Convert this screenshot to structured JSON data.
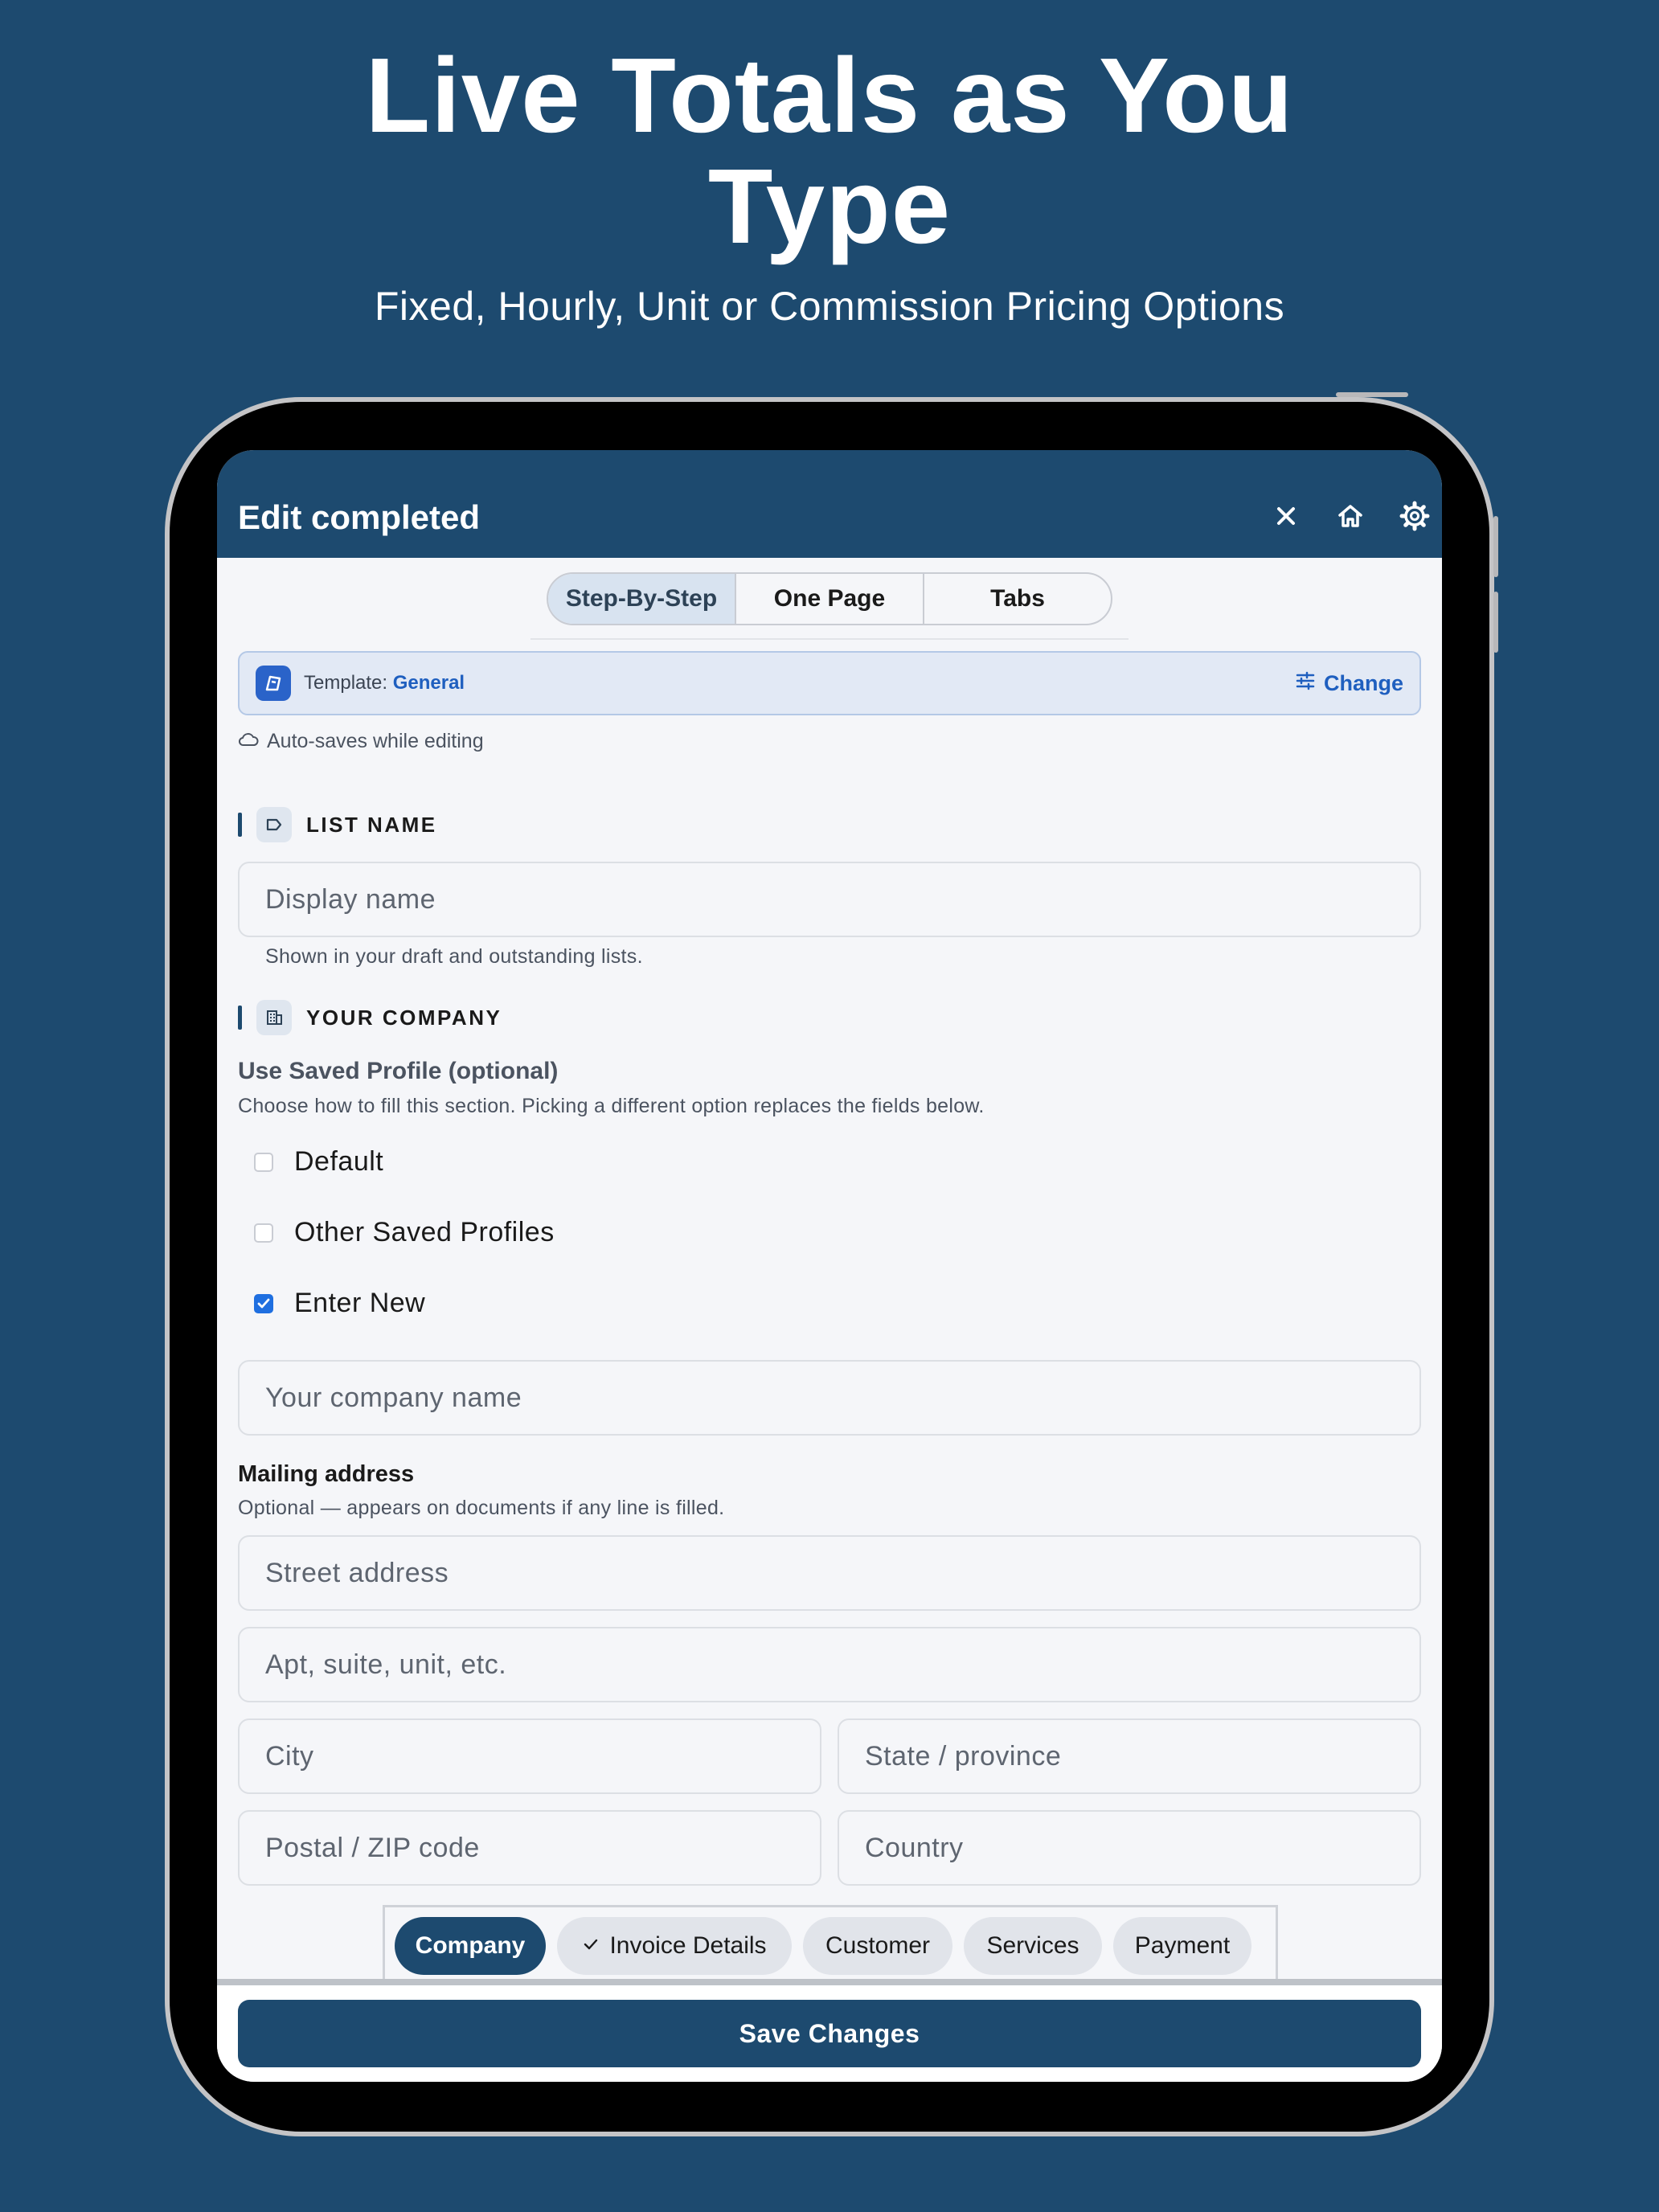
{
  "hero": {
    "title_line1": "Live Totals as You",
    "title_line2": "Type",
    "subtitle": "Fixed, Hourly, Unit or Commission Pricing Options"
  },
  "appbar": {
    "title": "Edit completed",
    "icons": [
      "close-icon",
      "home-icon",
      "gear-icon"
    ]
  },
  "layout_modes": {
    "options": [
      "Step-By-Step",
      "One Page",
      "Tabs"
    ],
    "selected": "Step-By-Step"
  },
  "template": {
    "prefix": "Template: ",
    "name": "General",
    "change_label": "Change"
  },
  "autosave_text": "Auto-saves while editing",
  "list_name": {
    "section_label": "LIST NAME",
    "placeholder": "Display name",
    "helper": "Shown in your draft and outstanding lists."
  },
  "company": {
    "section_label": "YOUR COMPANY",
    "saved_profile_label": "Use Saved Profile (optional)",
    "saved_profile_helper": "Choose how to fill this section. Picking a different option replaces the fields below.",
    "options": [
      {
        "label": "Default",
        "checked": false
      },
      {
        "label": "Other Saved Profiles",
        "checked": false
      },
      {
        "label": "Enter New",
        "checked": true
      }
    ],
    "name_placeholder": "Your company name",
    "mailing_label": "Mailing address",
    "mailing_helper": "Optional — appears on documents if any line is filled.",
    "street_placeholder": "Street address",
    "apt_placeholder": "Apt, suite, unit, etc.",
    "city_placeholder": "City",
    "state_placeholder": "State / province",
    "zip_placeholder": "Postal / ZIP code",
    "country_placeholder": "Country"
  },
  "steps": {
    "items": [
      {
        "label": "Company",
        "active": true,
        "done": false
      },
      {
        "label": "Invoice Details",
        "active": false,
        "done": true
      },
      {
        "label": "Customer",
        "active": false,
        "done": false
      },
      {
        "label": "Services",
        "active": false,
        "done": false
      },
      {
        "label": "Payment",
        "active": false,
        "done": false
      }
    ]
  },
  "save_label": "Save Changes",
  "colors": {
    "brand": "#1d4a6f",
    "accent": "#1f5fbf",
    "background": "#f5f6f9"
  }
}
